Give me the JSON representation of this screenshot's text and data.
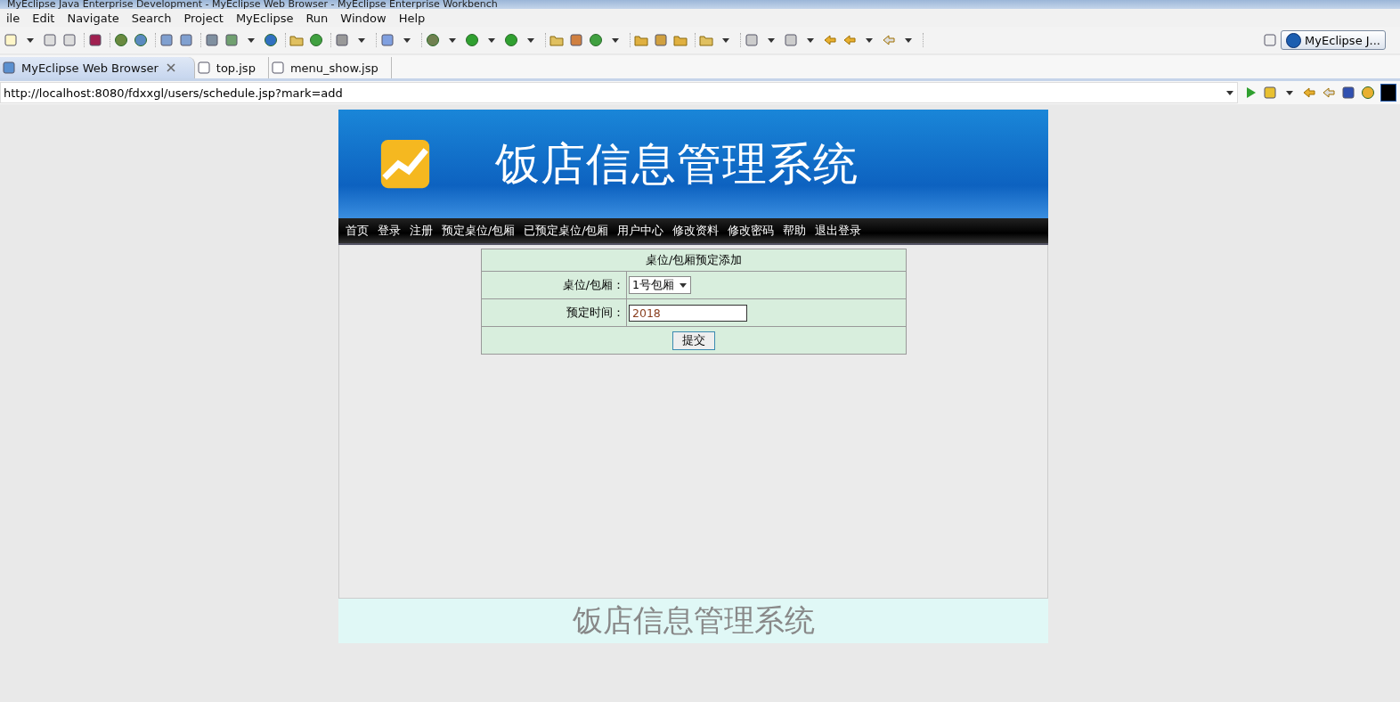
{
  "window": {
    "title": "MyEclipse Java Enterprise Development - MyEclipse Web Browser - MyEclipse Enterprise Workbench"
  },
  "menu": [
    "ile",
    "Edit",
    "Navigate",
    "Search",
    "Project",
    "MyEclipse",
    "Run",
    "Window",
    "Help"
  ],
  "perspective": {
    "label": "MyEclipse J..."
  },
  "editor_tabs": [
    {
      "label": "MyEclipse Web Browser",
      "selected": true,
      "closable": true
    },
    {
      "label": "top.jsp",
      "selected": false,
      "closable": false
    },
    {
      "label": "menu_show.jsp",
      "selected": false,
      "closable": false
    }
  ],
  "address": {
    "value": "http://localhost:8080/fdxxgl/users/schedule.jsp?mark=add"
  },
  "site": {
    "banner_title": "饭店信息管理系统",
    "nav": [
      "首页",
      "登录",
      "注册",
      "预定桌位/包厢",
      "已预定桌位/包厢",
      "用户中心",
      "修改资料",
      "修改密码",
      "帮助",
      "退出登录"
    ],
    "form": {
      "title": "桌位/包厢预定添加",
      "fields": [
        {
          "kind": "select",
          "label": "桌位/包厢：",
          "value": "1号包厢"
        },
        {
          "kind": "text",
          "label": "预定时间：",
          "value": "2018"
        }
      ],
      "submit": "提交"
    },
    "footer": "饭店信息管理系统"
  }
}
